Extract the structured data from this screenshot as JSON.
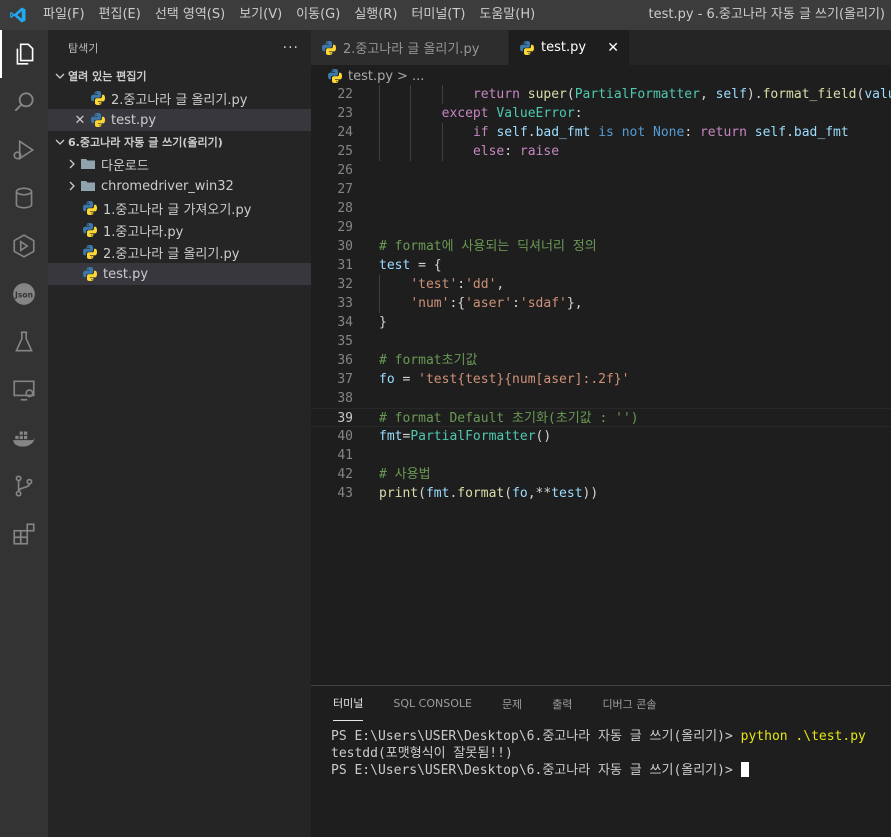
{
  "titlebar": {
    "menu": [
      "파일(F)",
      "편집(E)",
      "선택 영역(S)",
      "보기(V)",
      "이동(G)",
      "실행(R)",
      "터미널(T)",
      "도움말(H)"
    ],
    "window_title": "test.py - 6.중고나라 자동 글 쓰기(올리기)"
  },
  "activity_bar": {
    "icons": [
      "explorer-icon",
      "search-icon",
      "run-debug-icon",
      "database-icon",
      "live-share-icon",
      "json-icon",
      "test-flask-icon",
      "remote-explorer-icon",
      "docker-icon",
      "source-control-icon",
      "extensions-icon"
    ]
  },
  "sidebar": {
    "title": "탐색기",
    "more": "···",
    "open_editors": {
      "title": "열려 있는 편집기",
      "files": [
        "2.중고나라 글 올리기.py",
        "test.py"
      ]
    },
    "workspace": {
      "title": "6.중고나라 자동 글 쓰기(올리기)",
      "folders": [
        "다운로드",
        "chromedriver_win32"
      ],
      "files": [
        "1.중고나라 글 가져오기.py",
        "1.중고나라.py",
        "2.중고나라 글 올리기.py",
        "test.py"
      ]
    }
  },
  "tabs": [
    {
      "label": "2.중고나라 글 올리기.py",
      "active": false
    },
    {
      "label": "test.py",
      "active": true
    }
  ],
  "tab_close": "✕",
  "breadcrumb": {
    "file": "test.py",
    "separator": ">",
    "rest": "..."
  },
  "code": {
    "current_line": 39,
    "lines": [
      {
        "n": "22",
        "text": "return super(PartialFormatter, self).format_field(value"
      },
      {
        "n": "23",
        "text": "except ValueError:"
      },
      {
        "n": "24",
        "text": "if self.bad_fmt is not None: return self.bad_fmt"
      },
      {
        "n": "25",
        "text": "else: raise"
      },
      {
        "n": "26",
        "text": ""
      },
      {
        "n": "27",
        "text": ""
      },
      {
        "n": "28",
        "text": ""
      },
      {
        "n": "29",
        "text": ""
      },
      {
        "n": "30",
        "text": "# format에 사용되는 딕셔너리 정의"
      },
      {
        "n": "31",
        "text": "test = {"
      },
      {
        "n": "32",
        "text": "'test':'dd',"
      },
      {
        "n": "33",
        "text": "'num':{'aser':'sdaf'},"
      },
      {
        "n": "34",
        "text": "}"
      },
      {
        "n": "35",
        "text": ""
      },
      {
        "n": "36",
        "text": "# format초기값"
      },
      {
        "n": "37",
        "text": "fo = 'test{test}{num[aser]:.2f}'"
      },
      {
        "n": "38",
        "text": ""
      },
      {
        "n": "39",
        "text": "# format Default 초기화(초기값 : '')"
      },
      {
        "n": "40",
        "text": "fmt=PartialFormatter()"
      },
      {
        "n": "41",
        "text": ""
      },
      {
        "n": "42",
        "text": "# 사용법"
      },
      {
        "n": "43",
        "text": "print(fmt.format(fo,**test))"
      }
    ]
  },
  "panel": {
    "tabs": [
      "터미널",
      "SQL CONSOLE",
      "문제",
      "출력",
      "디버그 콘솔"
    ],
    "terminal": {
      "prompt": "PS E:\\Users\\USER\\Desktop\\6.중고나라 자동 글 쓰기(올리기)> ",
      "command": "python .\\test.py",
      "output": "testdd(포맷형식이 잘못됨!!)"
    }
  },
  "colors": {
    "keyword": "#c586c0",
    "string": "#ce9178",
    "comment": "#6a9955",
    "variable": "#9cdcfe",
    "function": "#dcdcaa",
    "class": "#4ec9b0"
  }
}
